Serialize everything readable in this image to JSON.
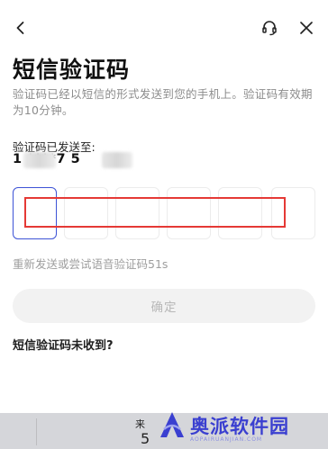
{
  "header": {
    "back_icon": "chevron-left-icon",
    "support_icon": "headset-icon",
    "close_icon": "close-icon"
  },
  "title": "短信验证码",
  "description": "验证码已经以短信的形式发送到您的手机上。验证码有效期为10分钟。",
  "sent_label": "验证码已发送至:",
  "phone_masked": "1 ****7 5",
  "code_input": {
    "length": 6,
    "active_index": 0,
    "values": [
      "",
      "",
      "",
      "",
      "",
      ""
    ],
    "colors": {
      "active_border": "#3d53d6",
      "highlight": "#e53935"
    }
  },
  "resend_text": "重新发送或尝试语音验证码51s",
  "confirm_label": "确定",
  "not_received_link": "短信验证码未收到?",
  "keyboard": {
    "char": "来",
    "num": "5"
  },
  "watermark": {
    "text": "奥派软件园",
    "sub": "AOPAIRUANJIAN.COM",
    "color": "#3a3fd0"
  }
}
